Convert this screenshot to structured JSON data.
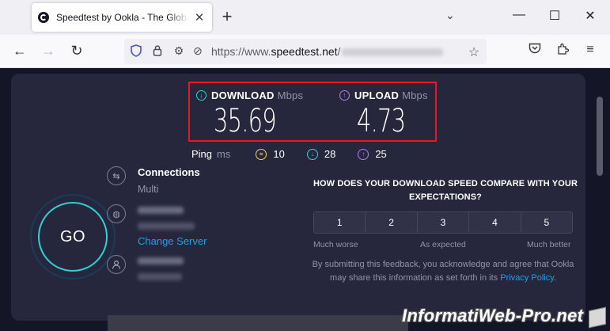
{
  "browser": {
    "tab_title": "Speedtest by Ookla - The Global Broadband Speed Test",
    "tab_close": "✕",
    "new_tab": "+",
    "tab_list": "⌄",
    "minimize": "—",
    "maximize": "☐",
    "close": "✕",
    "url_prefix": "https://www.",
    "url_domain": "speedtest.net",
    "url_path": "/"
  },
  "results": {
    "download_label": "DOWNLOAD",
    "download_unit": "Mbps",
    "download_value": "35.69",
    "upload_label": "UPLOAD",
    "upload_unit": "Mbps",
    "upload_value": "4.73"
  },
  "ping": {
    "label": "Ping",
    "unit": "ms",
    "idle": "10",
    "download": "28",
    "upload": "25"
  },
  "go_label": "GO",
  "connections": {
    "title": "Connections",
    "value": "Multi"
  },
  "server": {
    "change_link": "Change Server"
  },
  "survey": {
    "question": "HOW DOES YOUR DOWNLOAD SPEED COMPARE WITH YOUR EXPECTATIONS?",
    "options": [
      "1",
      "2",
      "3",
      "4",
      "5"
    ],
    "low_label": "Much worse",
    "mid_label": "As expected",
    "high_label": "Much better",
    "disclaimer": "By submitting this feedback, you acknowledge and agree that Ookla may share this information as set forth in its",
    "policy_link": "Privacy Policy",
    "disclaimer_end": "."
  },
  "watermark": "InformatiWeb-Pro.net",
  "colors": {
    "page_bg": "#141526",
    "panel_bg": "#26273c",
    "highlight_border": "#e21b23",
    "download_accent": "#2fd1d8",
    "upload_accent": "#b07cf0",
    "ping_idle_accent": "#f4d442",
    "link": "#1ca0e8"
  }
}
